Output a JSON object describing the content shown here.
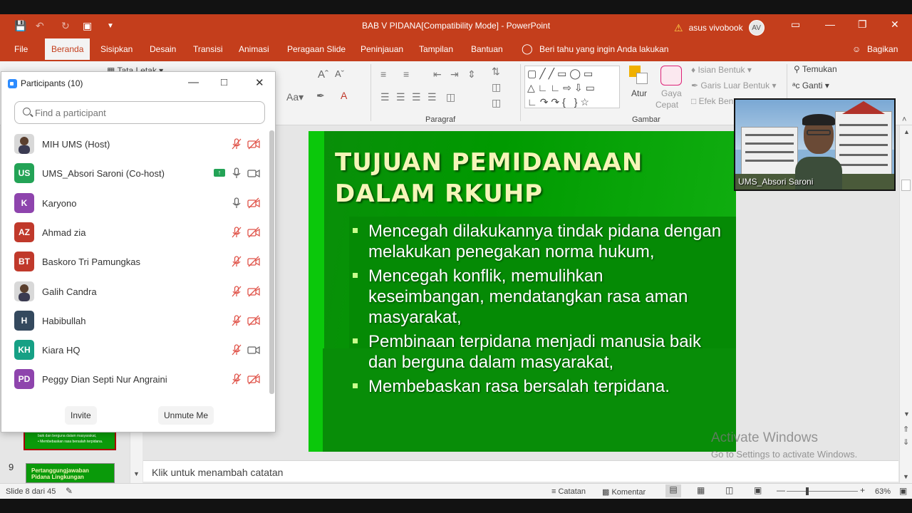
{
  "app": {
    "title": "BAB V PIDANA[Compatibility Mode]  -  PowerPoint",
    "warning_icon": "warning-icon",
    "user_name": "asus vivobook",
    "user_initials": "AV"
  },
  "menu": {
    "tabs": [
      "File",
      "Beranda",
      "Sisipkan",
      "Desain",
      "Transisi",
      "Animasi",
      "Peragaan Slide",
      "Peninjauan",
      "Tampilan",
      "Bantuan"
    ],
    "active_tab": "Beranda",
    "tell_me": "Beri tahu yang ingin Anda lakukan",
    "share": "Bagikan"
  },
  "ribbon": {
    "layout_label": "Tata Letak",
    "paragraph_label": "Paragraf",
    "drawing_label": "Gambar",
    "arrange": "Atur",
    "quick_styles_1": "Gaya",
    "quick_styles_2": "Cepat",
    "shape_fill": "Isian Bentuk",
    "shape_outline": "Garis Luar Bentuk",
    "shape_effects": "Efek Ben",
    "find": "Temukan",
    "replace": "Ganti"
  },
  "slide": {
    "title_line1": "TUJUAN PEMIDANAAN",
    "title_line2": "DALAM RKUHP",
    "bullets": [
      "Mencegah dilakukannya tindak pidana dengan melakukan penegakan norma hukum,",
      "Mencegah konflik, memulihkan keseimbangan, mendatangkan rasa aman masyarakat,",
      "Pembinaan terpidana menjadi manusia baik dan berguna dalam masyarakat,",
      "Membebaskan rasa bersalah terpidana."
    ]
  },
  "thumbnails": {
    "slide9_number": "9",
    "slide9_title": "Pertanggungjawaban Pidana Lingkungan",
    "slide8_line1": "baik dan berguna dalam masyarakat,",
    "slide8_line2": "• Membebaskan rasa bersalah terpidana."
  },
  "notes": {
    "placeholder": "Klik untuk menambah catatan"
  },
  "status": {
    "slide_info": "Slide 8 dari 45",
    "notes_button": "Catatan",
    "comments_button": "Komentar",
    "zoom": "63%"
  },
  "video": {
    "name": "UMS_Absori Saroni"
  },
  "watermark": {
    "title": "Activate Windows",
    "subtitle": "Go to Settings to activate Windows."
  },
  "participants": {
    "title": "Participants (10)",
    "search_placeholder": "Find a participant",
    "invite": "Invite",
    "unmute_me": "Unmute Me",
    "list": [
      {
        "name": "MIH UMS (Host)",
        "initials": "",
        "color": "#ffffff",
        "mic": "muted",
        "cam": "off",
        "photo": true
      },
      {
        "name": "UMS_Absori Saroni (Co-host)",
        "initials": "US",
        "color": "#23a356",
        "mic": "on",
        "cam": "on",
        "sharing": true
      },
      {
        "name": "Karyono",
        "initials": "K",
        "color": "#8e44ad",
        "mic": "on",
        "cam": "off"
      },
      {
        "name": "Ahmad zia",
        "initials": "AZ",
        "color": "#c0392b",
        "mic": "muted",
        "cam": "off"
      },
      {
        "name": "Baskoro Tri Pamungkas",
        "initials": "BT",
        "color": "#c0392b",
        "mic": "muted",
        "cam": "off"
      },
      {
        "name": "Galih Candra",
        "initials": "",
        "color": "#ffffff",
        "mic": "muted",
        "cam": "off",
        "photo": true
      },
      {
        "name": "Habibullah",
        "initials": "H",
        "color": "#34495e",
        "mic": "muted",
        "cam": "off"
      },
      {
        "name": "Kiara HQ",
        "initials": "KH",
        "color": "#16a085",
        "mic": "muted",
        "cam": "on"
      },
      {
        "name": "Peggy Dian Septi Nur Angraini",
        "initials": "PD",
        "color": "#8e44ad",
        "mic": "muted",
        "cam": "off"
      }
    ]
  }
}
